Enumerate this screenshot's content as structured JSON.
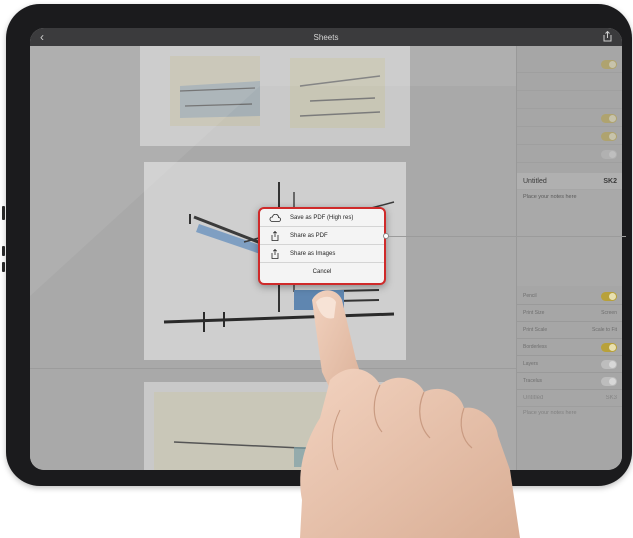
{
  "navbar": {
    "title": "Sheets",
    "back_icon": "chevron-left-icon",
    "share_icon": "share-icon"
  },
  "popup": {
    "items": [
      {
        "label": "Save as PDF (High res)",
        "icon": "cloud-icon"
      },
      {
        "label": "Share as PDF",
        "icon": "share-icon"
      },
      {
        "label": "Share as Images",
        "icon": "share-icon"
      }
    ],
    "cancel_label": "Cancel",
    "highlight_color": "#cf2a2a"
  },
  "sidebar": {
    "sheet_title": "Untitled",
    "sheet_code": "SK2",
    "notes_placeholder": "Place your notes here",
    "settings": [
      {
        "label": "Pencil",
        "type": "toggle",
        "on": true
      },
      {
        "label": "Print Size",
        "type": "value",
        "value": "Screen"
      },
      {
        "label": "Print Scale",
        "type": "value",
        "value": "Scale to Fit"
      },
      {
        "label": "Borderless",
        "type": "toggle",
        "on": true
      },
      {
        "label": "Layers",
        "type": "toggle",
        "on": false
      },
      {
        "label": "Tracelus",
        "type": "toggle",
        "on": false
      }
    ],
    "next_sheet_title": "Untitled",
    "next_sheet_code": "SK3",
    "next_notes_placeholder": "Place your notes here"
  },
  "colors": {
    "device": "#1b1b1d",
    "accent_toggle": "#b8a13a"
  }
}
